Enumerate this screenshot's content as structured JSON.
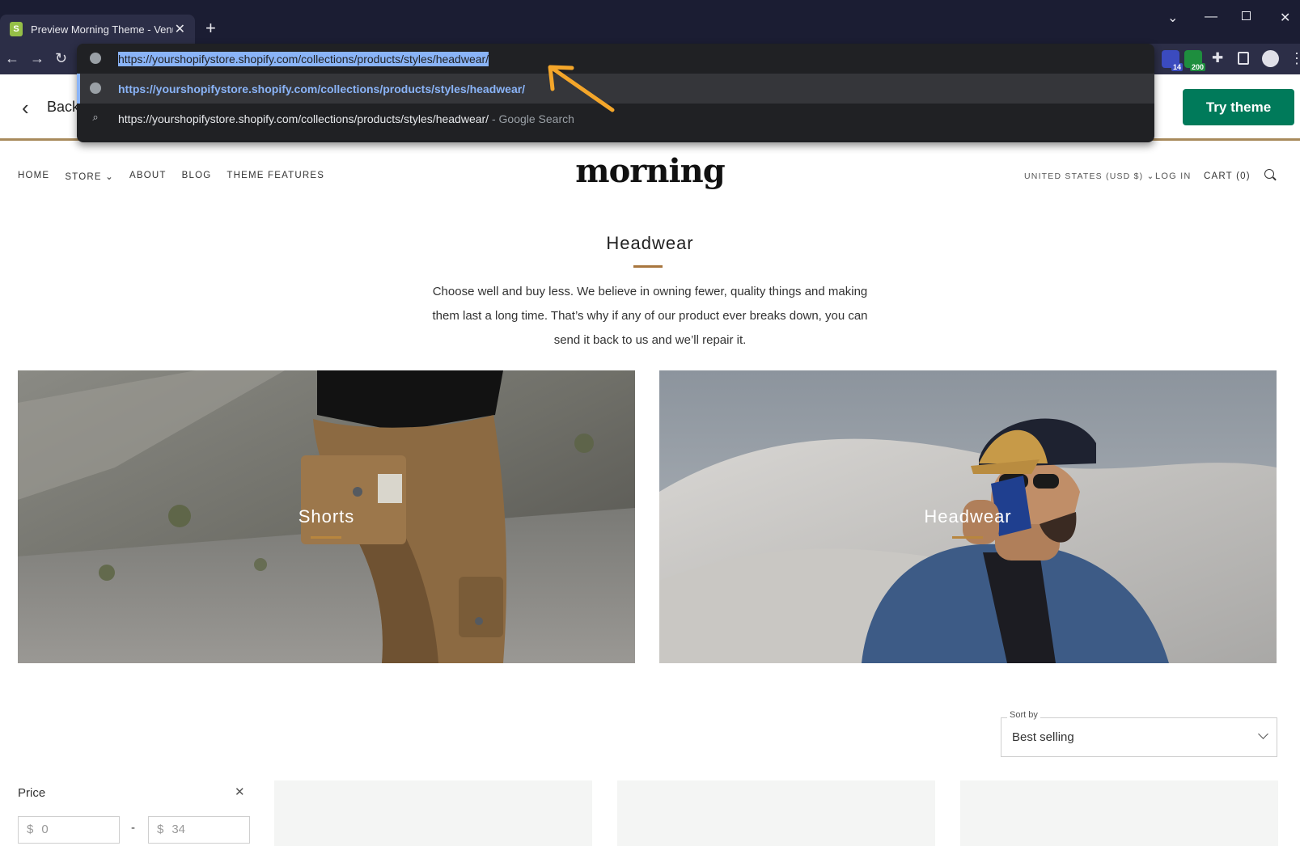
{
  "browser": {
    "tab_title": "Preview Morning Theme - Venue",
    "url": "https://yourshopifystore.shopify.com/collections/products/styles/headwear/",
    "suggestions": [
      {
        "text": "https://yourshopifystore.shopify.com/collections/products/styles/headwear/",
        "suffix": ""
      },
      {
        "text": "https://yourshopifystore.shopify.com/collections/products/styles/headwear/",
        "suffix": " - Google Search"
      }
    ],
    "extension_badges": [
      "14",
      "200"
    ]
  },
  "preview_bar": {
    "back_label": "Back",
    "try_button": "Try theme"
  },
  "store": {
    "logo": "morning",
    "nav": [
      "HOME",
      "STORE",
      "ABOUT",
      "BLOG",
      "THEME FEATURES"
    ],
    "currency": "UNITED STATES (USD $)",
    "login": "LOG IN",
    "cart": "CART (0)"
  },
  "collection": {
    "title": "Headwear",
    "description_lines": [
      "Choose well and buy less. We believe in owning fewer, quality things and making",
      "them last a long time. That’s why if any of our product ever breaks down, you can",
      "send it back to us and we’ll repair it."
    ],
    "tiles": [
      "Shorts",
      "Headwear"
    ]
  },
  "sort": {
    "label": "Sort by",
    "value": "Best selling"
  },
  "filter": {
    "price_label": "Price",
    "currency_symbol": "$",
    "min": "0",
    "max": "34",
    "dash": "-"
  },
  "colors": {
    "try_button": "#007a5a",
    "accent": "#a8763e",
    "chrome_dark": "#1b1d33",
    "url_selection": "#8ab4f8",
    "annotation_arrow": "#f4a62a"
  }
}
